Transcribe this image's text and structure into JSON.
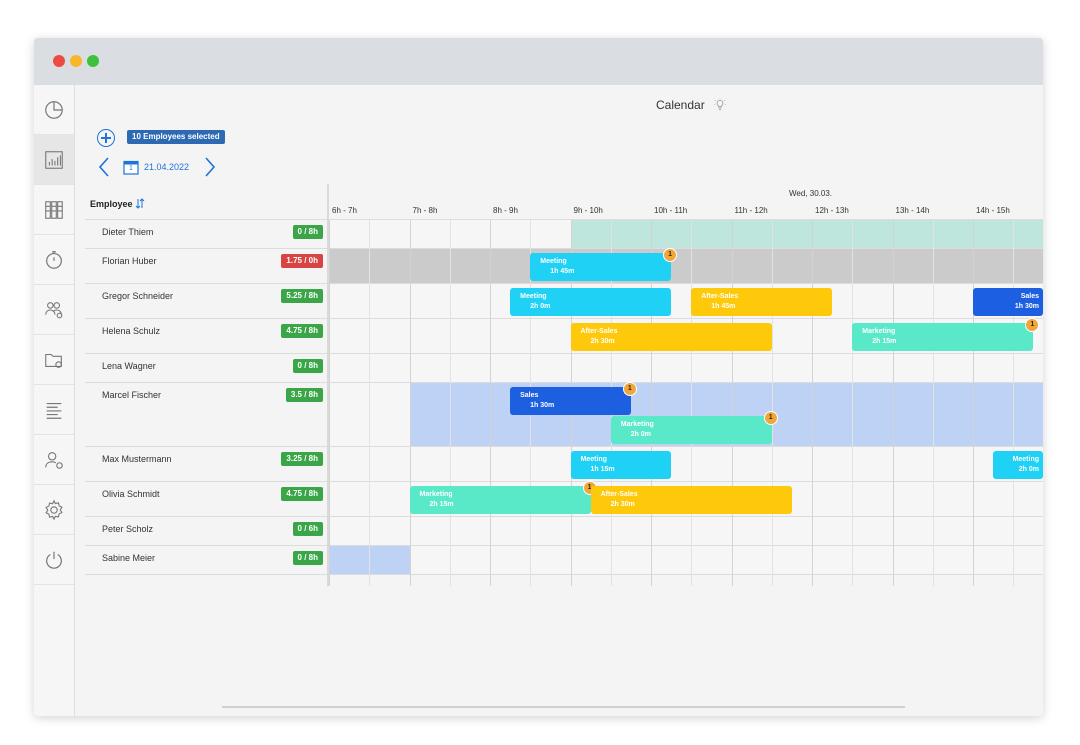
{
  "window": {
    "traffic_lights": [
      {
        "name": "close",
        "color": "#ee4b40"
      },
      {
        "name": "minimize",
        "color": "#f8b72a"
      },
      {
        "name": "maximize",
        "color": "#3dc13c"
      }
    ]
  },
  "sidebar": {
    "items": [
      {
        "icon": "pie-chart-icon",
        "active": false
      },
      {
        "icon": "bar-chart-icon",
        "active": true
      },
      {
        "icon": "binders-icon",
        "active": false
      },
      {
        "icon": "stopwatch-icon",
        "active": false
      },
      {
        "icon": "team-settings-icon",
        "active": false
      },
      {
        "icon": "folder-settings-icon",
        "active": false
      },
      {
        "icon": "list-icon",
        "active": false
      },
      {
        "icon": "user-settings-icon",
        "active": false
      },
      {
        "icon": "gear-icon",
        "active": false
      },
      {
        "icon": "power-icon",
        "active": false
      }
    ]
  },
  "header": {
    "title": "Calendar",
    "title_icon": "lightbulb-icon"
  },
  "toolbar": {
    "selection_badge": "10 Employees selected",
    "date": "21.04.2022",
    "calendar_day": "1"
  },
  "grid": {
    "employee_column_label": "Employee",
    "day_label": "Wed, 30.03.",
    "hours": [
      "6h - 7h",
      "7h - 8h",
      "8h - 9h",
      "9h - 10h",
      "10h - 11h",
      "11h - 12h",
      "12h - 13h",
      "13h - 14h",
      "14h - 15h"
    ],
    "colors": {
      "meeting": "#1fd1f5",
      "sales": "#1c5fe0",
      "after_sales": "#fdc90a",
      "marketing": "#5ae9c8"
    },
    "employees": [
      {
        "name": "Dieter Thiem",
        "hours": "0 / 8h",
        "status": "green",
        "rows": 1
      },
      {
        "name": "Florian Huber",
        "hours": "1.75 / 0h",
        "status": "red",
        "rows": 1
      },
      {
        "name": "Gregor Schneider",
        "hours": "5.25 / 8h",
        "status": "green",
        "rows": 1
      },
      {
        "name": "Helena Schulz",
        "hours": "4.75 / 8h",
        "status": "green",
        "rows": 1
      },
      {
        "name": "Lena Wagner",
        "hours": "0 / 8h",
        "status": "green",
        "rows": 1
      },
      {
        "name": "Marcel Fischer",
        "hours": "3.5 / 8h",
        "status": "green",
        "rows": 2
      },
      {
        "name": "Max Mustermann",
        "hours": "3.25 / 8h",
        "status": "green",
        "rows": 1
      },
      {
        "name": "Olivia Schmidt",
        "hours": "4.75 / 8h",
        "status": "green",
        "rows": 1
      },
      {
        "name": "Peter Scholz",
        "hours": "0 / 6h",
        "status": "green",
        "rows": 1
      },
      {
        "name": "Sabine Meier",
        "hours": "0 / 8h",
        "status": "green",
        "rows": 1
      }
    ],
    "shading": [
      {
        "row": 0,
        "start": 9,
        "end": 15.8,
        "color": "#bfe6dc"
      },
      {
        "row": 1,
        "start": 6,
        "end": 15.8,
        "color": "#cbcbcb"
      },
      {
        "row": 5,
        "start": 7,
        "end": 15.8,
        "color": "#bdd2f4"
      },
      {
        "row": 9,
        "start": 6,
        "end": 7,
        "color": "#bdd2f4"
      }
    ],
    "events": [
      {
        "row": 1,
        "sub": 0,
        "type": "meeting",
        "title": "Meeting",
        "duration": "1h 45m",
        "start": 8.5,
        "end": 10.25,
        "badge": "1"
      },
      {
        "row": 2,
        "sub": 0,
        "type": "meeting",
        "title": "Meeting",
        "duration": "2h 0m",
        "start": 8.25,
        "end": 10.25,
        "badge": ""
      },
      {
        "row": 2,
        "sub": 0,
        "type": "after_sales",
        "title": "After-Sales",
        "duration": "1h 45m",
        "start": 10.5,
        "end": 12.25,
        "badge": ""
      },
      {
        "row": 2,
        "sub": 0,
        "type": "sales",
        "title": "Sales",
        "duration": "1h 30m",
        "start": 14.0,
        "end": 15.8,
        "badge": ""
      },
      {
        "row": 3,
        "sub": 0,
        "type": "after_sales",
        "title": "After-Sales",
        "duration": "2h 30m",
        "start": 9.0,
        "end": 11.5,
        "badge": ""
      },
      {
        "row": 3,
        "sub": 0,
        "type": "marketing",
        "title": "Marketing",
        "duration": "2h 15m",
        "start": 12.5,
        "end": 14.75,
        "badge": "1"
      },
      {
        "row": 5,
        "sub": 0,
        "type": "sales",
        "title": "Sales",
        "duration": "1h 30m",
        "start": 8.25,
        "end": 9.75,
        "badge": "1"
      },
      {
        "row": 5,
        "sub": 1,
        "type": "marketing",
        "title": "Marketing",
        "duration": "2h 0m",
        "start": 9.5,
        "end": 11.5,
        "badge": "1"
      },
      {
        "row": 6,
        "sub": 0,
        "type": "meeting",
        "title": "Meeting",
        "duration": "1h 15m",
        "start": 9.0,
        "end": 10.25,
        "badge": ""
      },
      {
        "row": 6,
        "sub": 0,
        "type": "meeting",
        "title": "Meeting",
        "duration": "2h 0m",
        "start": 14.25,
        "end": 15.8,
        "badge": ""
      },
      {
        "row": 7,
        "sub": 0,
        "type": "marketing",
        "title": "Marketing",
        "duration": "2h 15m",
        "start": 7.0,
        "end": 9.25,
        "badge": "1"
      },
      {
        "row": 7,
        "sub": 0,
        "type": "after_sales",
        "title": "After-Sales",
        "duration": "2h 30m",
        "start": 9.25,
        "end": 11.75,
        "badge": ""
      }
    ]
  }
}
